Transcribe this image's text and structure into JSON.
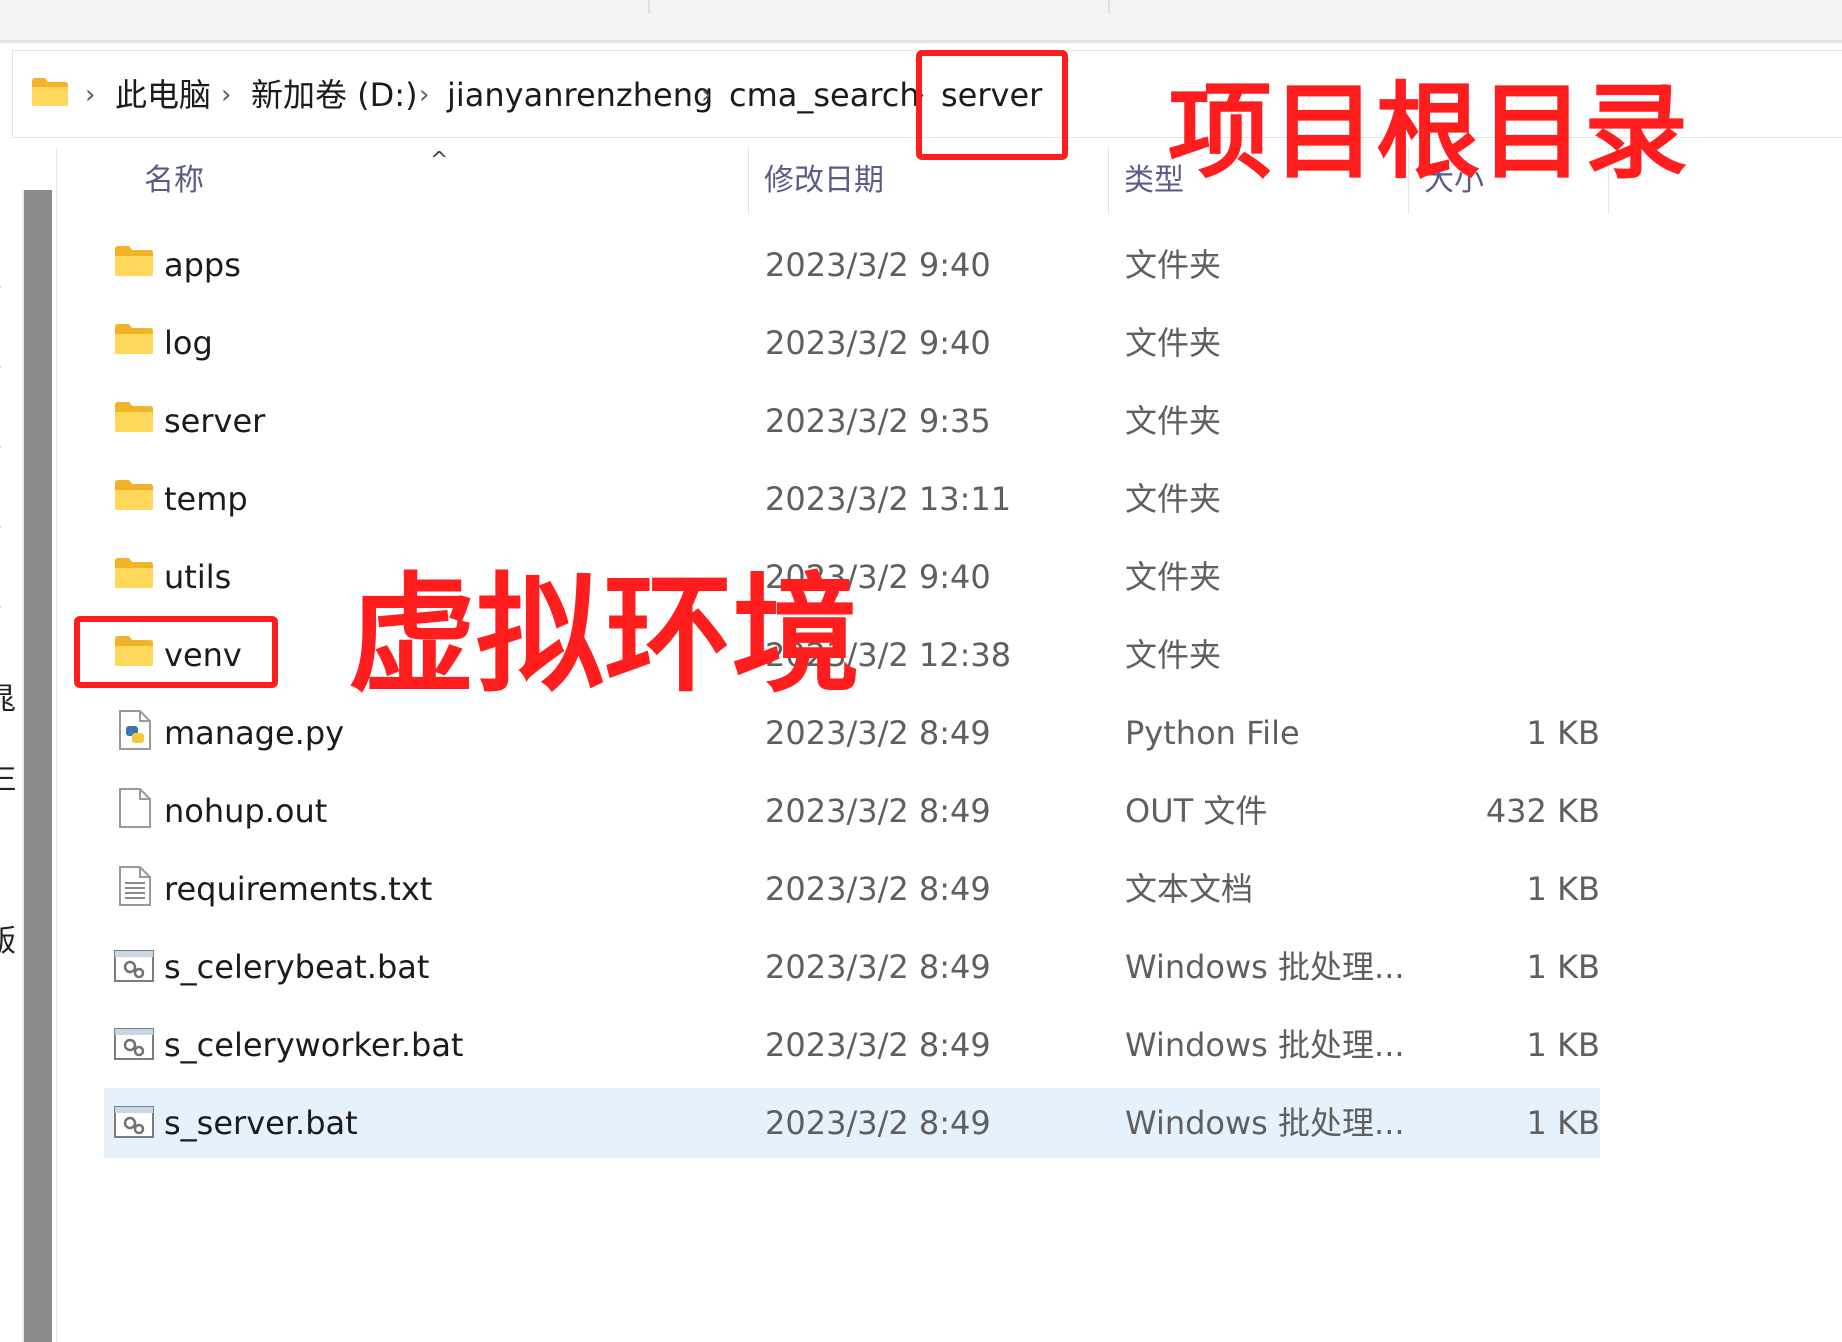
{
  "breadcrumb": [
    {
      "label": "此电脑"
    },
    {
      "label": "新加卷 (D:)"
    },
    {
      "label": "jianyanrenzheng"
    },
    {
      "label": "cma_search"
    },
    {
      "label": "server"
    }
  ],
  "columns": {
    "name": "名称",
    "date": "修改日期",
    "type": "类型",
    "size": "大小"
  },
  "left_pane_clipped": [
    "晁",
    "仨",
    "版"
  ],
  "files": [
    {
      "name": "apps",
      "date": "2023/3/2 9:40",
      "type": "文件夹",
      "size": "",
      "icon": "folder-icon"
    },
    {
      "name": "log",
      "date": "2023/3/2 9:40",
      "type": "文件夹",
      "size": "",
      "icon": "folder-icon"
    },
    {
      "name": "server",
      "date": "2023/3/2 9:35",
      "type": "文件夹",
      "size": "",
      "icon": "folder-icon"
    },
    {
      "name": "temp",
      "date": "2023/3/2 13:11",
      "type": "文件夹",
      "size": "",
      "icon": "folder-icon"
    },
    {
      "name": "utils",
      "date": "2023/3/2 9:40",
      "type": "文件夹",
      "size": "",
      "icon": "folder-icon"
    },
    {
      "name": "venv",
      "date": "2023/3/2 12:38",
      "type": "文件夹",
      "size": "",
      "icon": "folder-icon"
    },
    {
      "name": "manage.py",
      "date": "2023/3/2 8:49",
      "type": "Python File",
      "size": "1 KB",
      "icon": "python-file-icon"
    },
    {
      "name": "nohup.out",
      "date": "2023/3/2 8:49",
      "type": "OUT 文件",
      "size": "432 KB",
      "icon": "blank-file-icon"
    },
    {
      "name": "requirements.txt",
      "date": "2023/3/2 8:49",
      "type": "文本文档",
      "size": "1 KB",
      "icon": "text-file-icon"
    },
    {
      "name": "s_celerybeat.bat",
      "date": "2023/3/2 8:49",
      "type": "Windows 批处理...",
      "size": "1 KB",
      "icon": "batch-file-icon"
    },
    {
      "name": "s_celeryworker.bat",
      "date": "2023/3/2 8:49",
      "type": "Windows 批处理...",
      "size": "1 KB",
      "icon": "batch-file-icon"
    },
    {
      "name": "s_server.bat",
      "date": "2023/3/2 8:49",
      "type": "Windows 批处理...",
      "size": "1 KB",
      "icon": "batch-file-icon",
      "selected": true
    }
  ],
  "annotations": {
    "root": "项目根目录",
    "venv": "虚拟环境",
    "color": "#ff1d1d"
  },
  "colors": {
    "selected_row": "#e5f1fb",
    "folder": "#f8c840",
    "header_text": "#5b5b8a"
  }
}
